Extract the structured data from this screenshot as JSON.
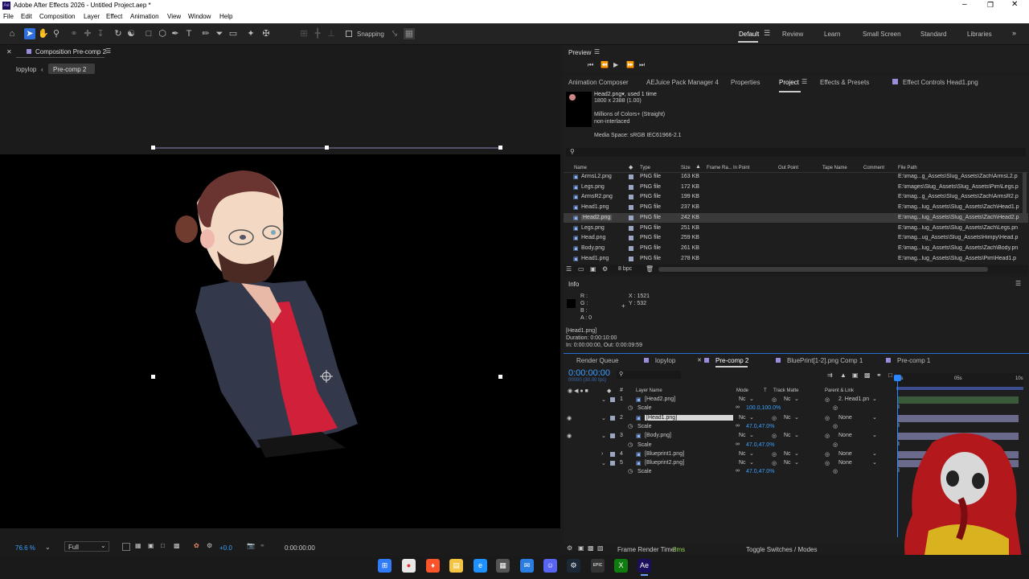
{
  "window": {
    "title": "Adobe After Effects 2026 - Untitled Project.aep *",
    "app_icon": "Ae"
  },
  "menu": [
    "File",
    "Edit",
    "Composition",
    "Layer",
    "Effect",
    "Animation",
    "View",
    "Window",
    "Help"
  ],
  "toolbar": {
    "snapping": "Snapping"
  },
  "workspaces": [
    "Default",
    "Review",
    "Learn",
    "Small Screen",
    "Standard",
    "Libraries"
  ],
  "comp_panel": {
    "title": "Composition Pre-comp 2",
    "crumbs": [
      "lopylop",
      "Pre-comp 2"
    ],
    "zoom": "76.6 %",
    "resolution": "Full",
    "exposure": "+0.0",
    "timecode": "0:00:00:00"
  },
  "preview": {
    "title": "Preview"
  },
  "project_tabs": [
    "Animation Composer",
    "AEJuice Pack Manager 4",
    "Properties",
    "Project",
    "Effects & Presets",
    "Effect Controls Head1.png"
  ],
  "project_info": {
    "name": "Head2.png",
    "used": ", used 1 time",
    "dims": "1800 x 2388 (1.00)",
    "colors": "Millions of Colors+ (Straight)",
    "interlace": "non-interlaced",
    "media_space": "Media Space: sRGB IEC61966-2.1"
  },
  "project_columns": [
    "Name",
    "Type",
    "Size",
    "Frame Ra...",
    "In Point",
    "Out Point",
    "Tape Name",
    "Comment",
    "File Path"
  ],
  "project_items": [
    {
      "name": "ArmsL2.png",
      "type": "PNG file",
      "size": "163 KB",
      "path": "E:\\imag...g_Assets\\Slug_Assets\\Zach\\ArmsL2.p"
    },
    {
      "name": "Legs.png",
      "type": "PNG file",
      "size": "172 KB",
      "path": "E:\\images\\Slug_Assets\\Slug_Assets\\Pim\\Legs.p"
    },
    {
      "name": "ArmsR2.png",
      "type": "PNG file",
      "size": "199 KB",
      "path": "E:\\imag...g_Assets\\Slug_Assets\\Zach\\ArmsR2.p"
    },
    {
      "name": "Head1.png",
      "type": "PNG file",
      "size": "237 KB",
      "path": "E:\\imag...lug_Assets\\Slug_Assets\\Zach\\Head1.p"
    },
    {
      "name": "Head2.png",
      "type": "PNG file",
      "size": "242 KB",
      "path": "E:\\imag...lug_Assets\\Slug_Assets\\Zach\\Head2.p"
    },
    {
      "name": "Legs.png",
      "type": "PNG file",
      "size": "251 KB",
      "path": "E:\\imag...lug_Assets\\Slug_Assets\\Zach\\Legs.pn"
    },
    {
      "name": "Head.png",
      "type": "PNG file",
      "size": "259 KB",
      "path": "E:\\imag...ug_Assets\\Slug_Assets\\Himpy\\Head.p"
    },
    {
      "name": "Body.png",
      "type": "PNG file",
      "size": "261 KB",
      "path": "E:\\imag...lug_Assets\\Slug_Assets\\Zach\\Body.pn"
    },
    {
      "name": "Head1.png",
      "type": "PNG file",
      "size": "278 KB",
      "path": "E:\\imag...lug_Assets\\Slug_Assets\\Pim\\Head1.p"
    }
  ],
  "project_footer": {
    "bpc": "8 bpc"
  },
  "info": {
    "title": "Info",
    "r": "R :",
    "g": "G :",
    "b": "B :",
    "a": "A : 0",
    "x": "X : 1521",
    "y": "Y : 532",
    "layer": "[Head1.png]",
    "duration": "Duration: 0:00:10:00",
    "inout": "In: 0:00:00:00, Out: 0:00:09:59"
  },
  "timeline_tabs": [
    "Render Queue",
    "lopylop",
    "Pre-comp 2",
    "BluePrint[1-2].png Comp 1",
    "Pre-comp 1"
  ],
  "timeline": {
    "timecode": "0:00:00:00",
    "fps": "00000 (30.00 fps)",
    "col_layer": "Layer Name",
    "col_mode": "Mode",
    "col_t": "T",
    "col_matte": "Track Matte",
    "col_parent": "Parent & Link",
    "ruler": [
      "0s",
      "05s",
      "10s"
    ],
    "footer_render": "Frame Render Time:",
    "footer_ms": "8ms",
    "footer_toggle": "Toggle Switches / Modes"
  },
  "layers": [
    {
      "num": "1",
      "name": "[Head2.png]",
      "mode": "Nc",
      "matte": "Nc",
      "parent": "2. Head1.pn"
    },
    {
      "prop": "Scale",
      "value": "100.0,100.0%"
    },
    {
      "num": "2",
      "name": "[Head1.png]",
      "mode": "Nc",
      "matte": "Nc",
      "parent": "None"
    },
    {
      "prop": "Scale",
      "value": "47.0,47.0%"
    },
    {
      "num": "3",
      "name": "[Body.png]",
      "mode": "Nc",
      "matte": "Nc",
      "parent": "None"
    },
    {
      "prop": "Scale",
      "value": "47.0,47.0%"
    },
    {
      "num": "4",
      "name": "[Blueprint1.png]",
      "mode": "Nc",
      "matte": "Nc",
      "parent": "None"
    },
    {
      "num": "5",
      "name": "[Blueprint2.png]",
      "mode": "Nc",
      "matte": "Nc",
      "parent": "None"
    },
    {
      "prop": "Scale",
      "value": "47.0,47.0%"
    }
  ],
  "taskbar": [
    "windows-start",
    "chrome",
    "brave",
    "file-explorer",
    "edge",
    "store",
    "mail",
    "discord",
    "steam",
    "epic-games",
    "xbox",
    "after-effects"
  ]
}
